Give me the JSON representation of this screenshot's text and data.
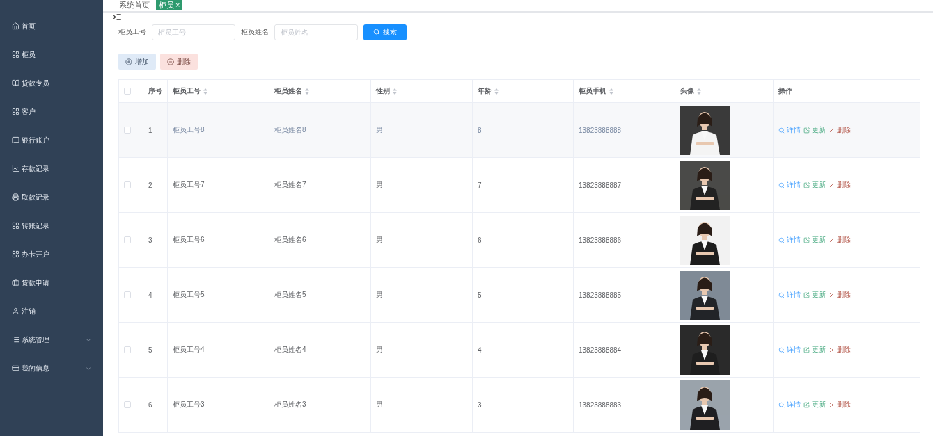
{
  "tabs": [
    {
      "label": "系统首页",
      "selected": false
    },
    {
      "label": "柜员",
      "selected": true,
      "close": "×"
    }
  ],
  "sidebar": {
    "items": [
      {
        "label": "首页",
        "expandable": false
      },
      {
        "label": "柜员",
        "expandable": false
      },
      {
        "label": "贷款专员",
        "expandable": false
      },
      {
        "label": "客户",
        "expandable": false
      },
      {
        "label": "银行账户",
        "expandable": false
      },
      {
        "label": "存款记录",
        "expandable": false
      },
      {
        "label": "取款记录",
        "expandable": false
      },
      {
        "label": "转账记录",
        "expandable": false
      },
      {
        "label": "办卡开户",
        "expandable": false
      },
      {
        "label": "贷款申请",
        "expandable": false
      },
      {
        "label": "注销",
        "expandable": false
      },
      {
        "label": "系统管理",
        "expandable": true
      },
      {
        "label": "我的信息",
        "expandable": true
      }
    ]
  },
  "search": {
    "fields": [
      {
        "label": "柜员工号",
        "placeholder": "柜员工号"
      },
      {
        "label": "柜员姓名",
        "placeholder": "柜员姓名"
      }
    ],
    "button": "搜索"
  },
  "toolbar": [
    {
      "label": "增加",
      "kind": "add"
    },
    {
      "label": "删除",
      "kind": "delete"
    }
  ],
  "table": {
    "all_checked": false,
    "columns": [
      {
        "label": "序号",
        "sortable": false
      },
      {
        "label": "柜员工号",
        "sortable": true
      },
      {
        "label": "柜员姓名",
        "sortable": true
      },
      {
        "label": "性别",
        "sortable": true
      },
      {
        "label": "年龄",
        "sortable": true
      },
      {
        "label": "柜员手机",
        "sortable": true
      },
      {
        "label": "头像",
        "sortable": true
      },
      {
        "label": "操作",
        "sortable": false
      }
    ],
    "rows": [
      {
        "checked": false,
        "highlighted": true,
        "cells": [
          "1",
          "柜员工号8",
          "柜员姓名8",
          "男",
          "8",
          "13823888888"
        ],
        "actions": [
          "详情",
          "更新",
          "删除"
        ]
      },
      {
        "checked": false,
        "highlighted": false,
        "cells": [
          "2",
          "柜员工号7",
          "柜员姓名7",
          "男",
          "7",
          "13823888887"
        ],
        "actions": [
          "详情",
          "更新",
          "删除"
        ]
      },
      {
        "checked": false,
        "highlighted": false,
        "cells": [
          "3",
          "柜员工号6",
          "柜员姓名6",
          "男",
          "6",
          "13823888886"
        ],
        "actions": [
          "详情",
          "更新",
          "删除"
        ]
      },
      {
        "checked": false,
        "highlighted": false,
        "cells": [
          "4",
          "柜员工号5",
          "柜员姓名5",
          "男",
          "5",
          "13823888885"
        ],
        "actions": [
          "详情",
          "更新",
          "删除"
        ]
      },
      {
        "checked": false,
        "highlighted": false,
        "cells": [
          "5",
          "柜员工号4",
          "柜员姓名4",
          "男",
          "4",
          "13823888884"
        ],
        "actions": [
          "详情",
          "更新",
          "删除"
        ]
      },
      {
        "checked": false,
        "highlighted": false,
        "cells": [
          "6",
          "柜员工号3",
          "柜员姓名3",
          "男",
          "3",
          "13823888883"
        ],
        "actions": [
          "详情",
          "更新",
          "删除"
        ]
      }
    ]
  }
}
